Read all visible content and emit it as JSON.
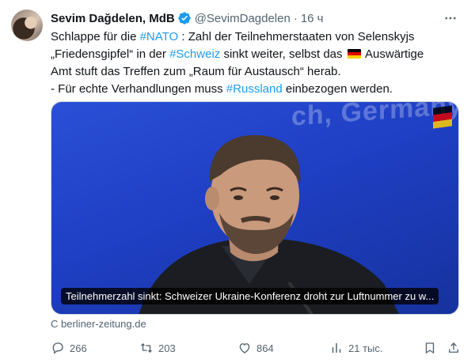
{
  "author": {
    "name": "Sevim Dağdelen, MdB",
    "handle": "@SevimDagdelen",
    "separator": "·",
    "time": "16 ч"
  },
  "text": {
    "l1_a": "Schlappe für die ",
    "l1_tag": "#NATO",
    "l1_b": " : Zahl der Teilnehmerstaaten von Selenskyjs",
    "l2_a": "„Friedensgipfel“ in der ",
    "l2_tag": "#Schweiz",
    "l2_b": " sinkt weiter, selbst das ",
    "l2_c": " Auswärtige",
    "l3": "Amt stuft das Treffen zum „Raum für Austausch“ herab.",
    "l4_a": "- Für echte Verhandlungen muss ",
    "l4_tag": "#Russland",
    "l4_b": " einbezogen werden."
  },
  "media": {
    "background_text": "ch, Germany",
    "caption": "Teilnehmerzahl sinkt: Schweizer Ukraine-Konferenz droht zur Luftnummer zu w..."
  },
  "source": "С berliner-zeitung.de",
  "actions": {
    "replies": "266",
    "reposts": "203",
    "likes": "864",
    "views": "21 тыс."
  },
  "icons": [
    "verified-icon",
    "more-icon",
    "reply-icon",
    "repost-icon",
    "like-icon",
    "views-icon",
    "bookmark-icon",
    "share-icon"
  ],
  "colors": {
    "accent": "#1d9bf0",
    "muted": "#536471",
    "text": "#0f1419"
  }
}
